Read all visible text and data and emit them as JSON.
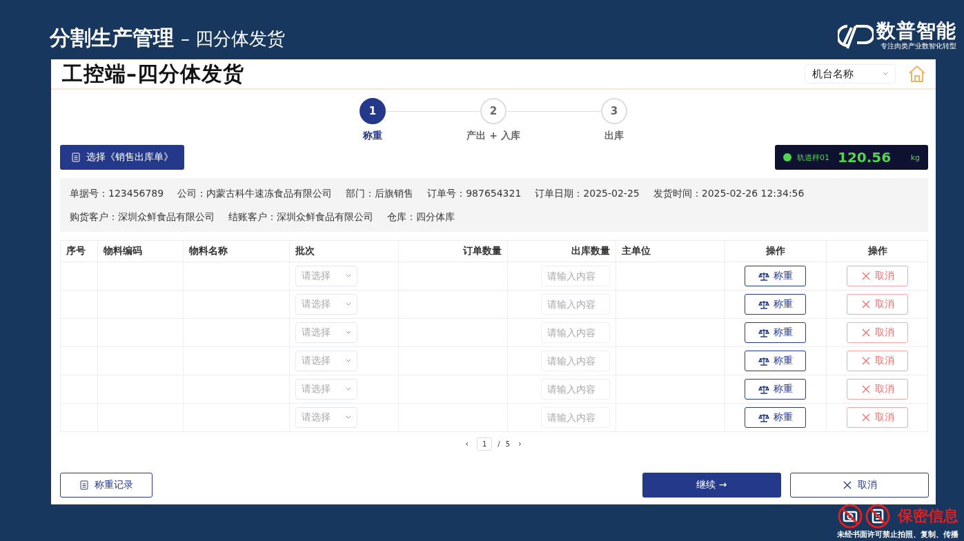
{
  "slide": {
    "title": "分割生产管理",
    "subtitle": "– 四分体发货"
  },
  "logo": {
    "name": "数普智能",
    "tagline": "专注肉类产业数智化转型"
  },
  "panel": {
    "title": "工控端–四分体发货",
    "machine_select": {
      "placeholder": "机台名称"
    }
  },
  "steps": [
    {
      "number": "1",
      "label": "称重",
      "selected": true
    },
    {
      "number": "2",
      "label": "产出 + 入库",
      "selected": false
    },
    {
      "number": "3",
      "label": "出库",
      "selected": false
    }
  ],
  "select_order_button": "选择《销售出库单》",
  "scale": {
    "name": "轨道秤01",
    "reading": "120.56",
    "unit": "kg",
    "online": true
  },
  "info": [
    [
      "单据号：123456789",
      "公司：内蒙古科牛速冻食品有限公司",
      "部门：后旗销售",
      "订单号：987654321",
      "订单日期：2025-02-25",
      "发货时间：2025-02-26 12:34:56"
    ],
    [
      "购货客户：深圳众鲜食品有限公司",
      "结账客户：深圳众鲜食品有限公司",
      "仓库：四分体库"
    ]
  ],
  "table": {
    "columns": [
      {
        "label": "序号",
        "kind": "text"
      },
      {
        "label": "物料编码",
        "kind": "text"
      },
      {
        "label": "物料名称",
        "kind": "text"
      },
      {
        "label": "批次",
        "kind": "text"
      },
      {
        "label": "订单数量",
        "kind": "number"
      },
      {
        "label": "出库数量",
        "kind": "number"
      },
      {
        "label": "主单位",
        "kind": "text"
      },
      {
        "label": "操作",
        "kind": "action"
      },
      {
        "label": "操作",
        "kind": "action"
      }
    ],
    "rows": [
      {
        "batch_placeholder": "请选择",
        "qty_placeholder": "请输入内容",
        "weigh": "称重",
        "cancel": "取消"
      },
      {
        "batch_placeholder": "请选择",
        "qty_placeholder": "请输入内容",
        "weigh": "称重",
        "cancel": "取消"
      },
      {
        "batch_placeholder": "请选择",
        "qty_placeholder": "请输入内容",
        "weigh": "称重",
        "cancel": "取消"
      },
      {
        "batch_placeholder": "请选择",
        "qty_placeholder": "请输入内容",
        "weigh": "称重",
        "cancel": "取消"
      },
      {
        "batch_placeholder": "请选择",
        "qty_placeholder": "请输入内容",
        "weigh": "称重",
        "cancel": "取消"
      },
      {
        "batch_placeholder": "请选择",
        "qty_placeholder": "请输入内容",
        "weigh": "称重",
        "cancel": "取消"
      }
    ]
  },
  "pagination": {
    "prev": "‹",
    "current": "1",
    "separator": "/",
    "total": "5",
    "next": "›"
  },
  "footer": {
    "records_button": "称重记录",
    "continue_button": "继续 →",
    "cancel_button": "取消"
  },
  "confidential": {
    "title": "保密信息",
    "notice": "未经书面许可禁止拍照、复制、传播"
  }
}
